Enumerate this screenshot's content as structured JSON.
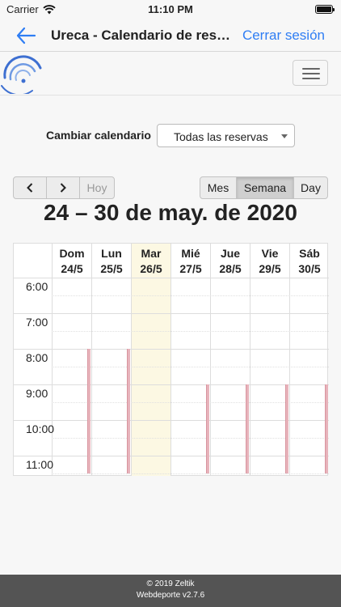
{
  "status_bar": {
    "carrier": "Carrier",
    "time": "11:10 PM"
  },
  "nav": {
    "title": "Ureca - Calendario de reservas",
    "logout_label": "Cerrar sesión"
  },
  "calendar_switch": {
    "label": "Cambiar calendario",
    "selected": "Todas las reservas"
  },
  "toolbar": {
    "prev_glyph": "‹",
    "next_glyph": "›",
    "today_label": "Hoy",
    "views": [
      {
        "label": "Mes",
        "active": false
      },
      {
        "label": "Semana",
        "active": true
      },
      {
        "label": "Day",
        "active": false
      }
    ]
  },
  "calendar": {
    "title": "24 – 30 de may. de 2020",
    "days": [
      {
        "name": "Dom",
        "date": "24/5",
        "today": false
      },
      {
        "name": "Lun",
        "date": "25/5",
        "today": false
      },
      {
        "name": "Mar",
        "date": "26/5",
        "today": true
      },
      {
        "name": "Mié",
        "date": "27/5",
        "today": false
      },
      {
        "name": "Jue",
        "date": "28/5",
        "today": false
      },
      {
        "name": "Vie",
        "date": "29/5",
        "today": false
      },
      {
        "name": "Sáb",
        "date": "30/5",
        "today": false
      }
    ],
    "hours": [
      "6:00",
      "7:00",
      "8:00",
      "9:00",
      "10:00",
      "11:00"
    ],
    "events": [
      {
        "day": 0,
        "start": "8:00",
        "end": "11:30"
      },
      {
        "day": 1,
        "start": "8:00",
        "end": "11:30"
      },
      {
        "day": 3,
        "start": "9:00",
        "end": "11:30"
      },
      {
        "day": 4,
        "start": "9:00",
        "end": "11:30"
      },
      {
        "day": 5,
        "start": "9:00",
        "end": "11:30"
      },
      {
        "day": 6,
        "start": "9:00",
        "end": "11:30"
      }
    ]
  },
  "colors": {
    "accent": "#2f7ef4",
    "today_bg": "#fcf8e3",
    "event": "#e7b3bb",
    "footer_bg": "#545454"
  },
  "footer": {
    "copyright": "© 2019 Zeltik",
    "version": "Webdeporte v2.7.6"
  }
}
